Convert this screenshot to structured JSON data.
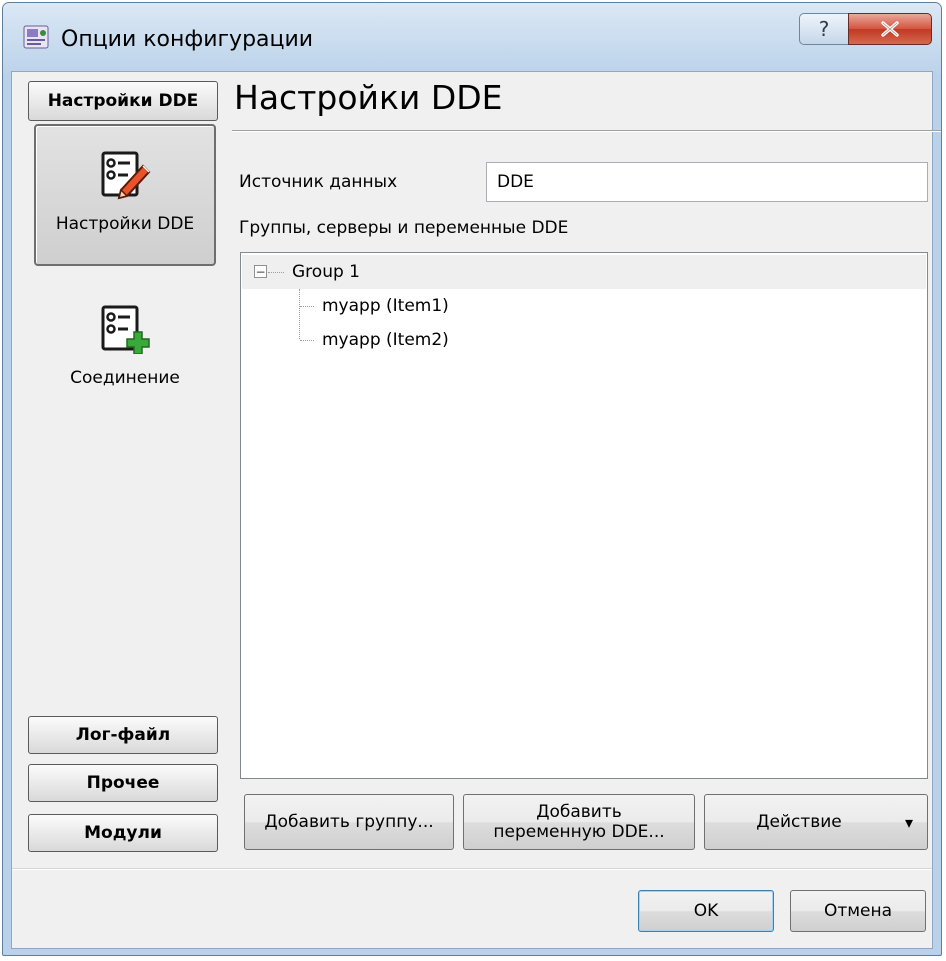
{
  "window": {
    "title": "Опции конфигурации",
    "help_glyph": "?",
    "close_glyph": "✕"
  },
  "sidebar": {
    "header_label": "Настройки DDE",
    "items": [
      {
        "label": "Настройки DDE",
        "icon": "checklist-pencil-icon",
        "selected": true
      },
      {
        "label": "Соединение",
        "icon": "checklist-plus-icon",
        "selected": false
      }
    ],
    "bottom_items": [
      {
        "label": "Лог-файл"
      },
      {
        "label": "Прочее"
      },
      {
        "label": "Модули"
      }
    ]
  },
  "main": {
    "title": "Настройки DDE",
    "source_label": "Источник данных",
    "source_value": "DDE",
    "tree_label": "Группы, серверы и переменные DDE",
    "tree": {
      "groups": [
        {
          "label": "Group 1",
          "expanded": true,
          "expander_glyph": "−",
          "children": [
            {
              "label": "myapp (Item1)"
            },
            {
              "label": "myapp (Item2)"
            }
          ]
        }
      ]
    },
    "buttons": {
      "add_group": "Добавить группу...",
      "add_var_line1": "Добавить",
      "add_var_line2": "переменную DDE...",
      "action": "Действие",
      "action_arrow": "▾"
    }
  },
  "footer": {
    "ok": "OK",
    "cancel": "Отмена"
  },
  "colors": {
    "close_button": "#c7432c",
    "title_gradient_top": "#dbe8f5",
    "client_background": "#f0f0f0",
    "tree_selection": "#efefef",
    "plus_badge": "#3aa83a"
  }
}
